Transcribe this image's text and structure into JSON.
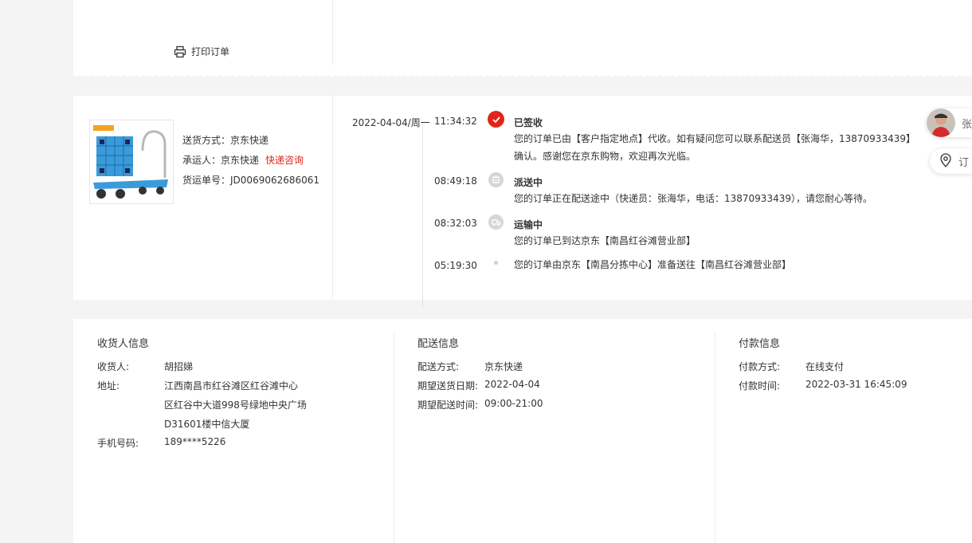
{
  "top": {
    "print_label": "打印订单"
  },
  "shipment": {
    "method_label": "送货方式：",
    "method_value": "京东快递",
    "carrier_label": "承运人：",
    "carrier_value": "京东快递",
    "carrier_link": "快递咨询",
    "waybill_label": "货运单号：",
    "waybill_value": "JD0069062686061"
  },
  "timeline": [
    {
      "date": "2022-04-04/周一",
      "time": "11:34:32",
      "title": "已签收",
      "desc": "您的订单已由【客户指定地点】代收。如有疑问您可以联系配送员【张海华，13870933439】确认。感谢您在京东购物，欢迎再次光临。",
      "icon": "check-icon"
    },
    {
      "date": "",
      "time": "08:49:18",
      "title": "派送中",
      "desc": "您的订单正在配送途中（快递员：张海华，电话：13870933439），请您耐心等待。",
      "icon": "delivery-icon"
    },
    {
      "date": "",
      "time": "08:32:03",
      "title": "运输中",
      "desc": "您的订单已到达京东【南昌红谷滩营业部】",
      "icon": "truck-icon"
    },
    {
      "date": "",
      "time": "05:19:30",
      "title": "",
      "desc": "您的订单由京东【南昌分拣中心】准备送往【南昌红谷滩营业部】",
      "icon": "dot-icon"
    }
  ],
  "floating": {
    "courier_name_partial": "张",
    "order_track_partial": "订"
  },
  "receiver": {
    "title": "收货人信息",
    "name_label": "收货人:",
    "name_value": "胡招娣",
    "address_label": "地址:",
    "address_lines": [
      "江西南昌市红谷滩区红谷滩中心",
      "区红谷中大道998号绿地中央广场",
      "D31601楼中信大厦"
    ],
    "phone_label": "手机号码:",
    "phone_value": "189****5226"
  },
  "delivery": {
    "title": "配送信息",
    "method_label": "配送方式:",
    "method_value": "京东快递",
    "date_label": "期望送货日期:",
    "date_value": "2022-04-04",
    "time_label": "期望配送时间:",
    "time_value": "09:00-21:00"
  },
  "payment": {
    "title": "付款信息",
    "method_label": "付款方式:",
    "method_value": "在线支付",
    "time_label": "付款时间:",
    "time_value": "2022-03-31 16:45:09"
  },
  "colors": {
    "accent": "#e1251b",
    "node_gray": "#d6d6d6",
    "border": "#eeeeee"
  }
}
